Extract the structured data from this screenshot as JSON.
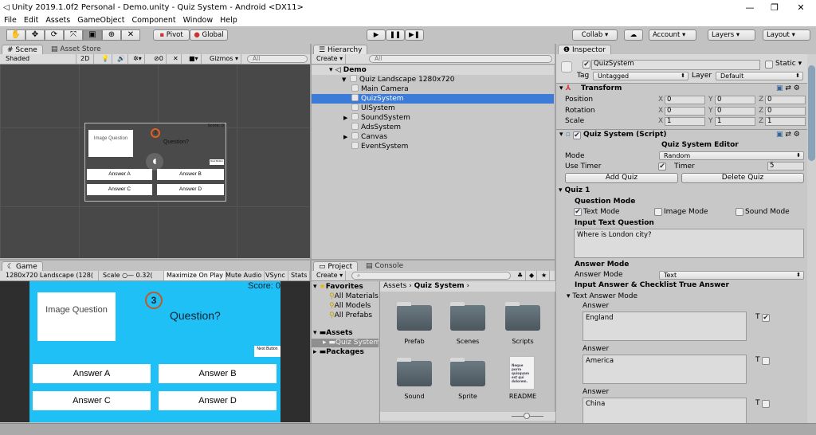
{
  "window": {
    "title": "Unity 2019.1.0f2 Personal - Demo.unity - Quiz System - Android <DX11>",
    "minimize": "—",
    "maximize": "❐",
    "close": "✕"
  },
  "menu": [
    "File",
    "Edit",
    "Assets",
    "GameObject",
    "Component",
    "Window",
    "Help"
  ],
  "toolbar": {
    "tools": [
      "✋",
      "✥",
      "⟳",
      "⤧",
      "▣",
      "⊕",
      "✕"
    ],
    "pivot": "Pivot",
    "global": "Global",
    "play": "▶",
    "pause": "❚❚",
    "step": "▶❚",
    "collab": "Collab ▾",
    "cloud": "☁",
    "account": "Account",
    "layers": "Layers",
    "layout": "Layout"
  },
  "scene": {
    "tab": "Scene",
    "tab2": "Asset Store",
    "shading": "Shaded",
    "mode2d": "2D",
    "hidden_count": "0",
    "gizmos": "Gizmos",
    "search": "All",
    "mini": {
      "image": "Image Question",
      "timer": "3",
      "question": "Question?",
      "score": "Score: 0",
      "next": "Next Button",
      "answers": [
        "Answer A",
        "Answer B",
        "Answer C",
        "Answer D"
      ]
    }
  },
  "game": {
    "tab": "Game",
    "resolution": "1280x720 Landscape (128(",
    "scale_label": "Scale",
    "scale_value": "0.32(",
    "maximize": "Maximize On Play",
    "mute": "Mute Audio",
    "vsync": "VSync",
    "stats": "Stats",
    "image": "Image Question",
    "timer": "3",
    "question": "Question?",
    "score": "Score: 0",
    "next": "Next Button",
    "answers": [
      "Answer A",
      "Answer B",
      "Answer C",
      "Answer D"
    ],
    "bg": "#1ec0f5"
  },
  "hierarchy": {
    "tab": "Hierarchy",
    "create": "Create",
    "search": "All",
    "scene": "Demo",
    "items": [
      {
        "label": "Quiz Landscape 1280x720",
        "depth": 1,
        "expand": "▼"
      },
      {
        "label": "Main Camera",
        "depth": 2,
        "expand": ""
      },
      {
        "label": "QuizSystem",
        "depth": 2,
        "expand": "",
        "selected": true
      },
      {
        "label": "UISystem",
        "depth": 2,
        "expand": ""
      },
      {
        "label": "SoundSystem",
        "depth": 2,
        "expand": "▶"
      },
      {
        "label": "AdsSystem",
        "depth": 2,
        "expand": ""
      },
      {
        "label": "Canvas",
        "depth": 2,
        "expand": "▶"
      },
      {
        "label": "EventSystem",
        "depth": 2,
        "expand": ""
      }
    ]
  },
  "project": {
    "tab": "Project",
    "tab2": "Console",
    "create": "Create",
    "favorites": "Favorites",
    "fav_items": [
      "All Materials",
      "All Models",
      "All Prefabs"
    ],
    "assets": "Assets",
    "quiz_folder": "Quiz System",
    "packages": "Packages",
    "breadcrumb": [
      "Assets",
      "Quiz System"
    ],
    "files": [
      "Prefab",
      "Scenes",
      "Scripts",
      "Sound",
      "Sprite",
      "README"
    ],
    "readme_preview": "Neque porro quisquam est qui dolorem."
  },
  "inspector": {
    "tab": "Inspector",
    "name": "QuizSystem",
    "static": "Static",
    "tag_label": "Tag",
    "tag": "Untagged",
    "layer_label": "Layer",
    "layer": "Default",
    "transform": {
      "title": "Transform",
      "rows": [
        {
          "label": "Position",
          "x": "0",
          "y": "0",
          "z": "0"
        },
        {
          "label": "Rotation",
          "x": "0",
          "y": "0",
          "z": "0"
        },
        {
          "label": "Scale",
          "x": "1",
          "y": "1",
          "z": "1"
        }
      ]
    },
    "script": {
      "title": "Quiz System (Script)",
      "editor_title": "Quiz System Editor",
      "mode_label": "Mode",
      "mode": "Random",
      "use_timer": "Use Timer",
      "timer_label": "Timer",
      "timer": "5",
      "add": "Add Quiz",
      "delete": "Delete Quiz"
    },
    "quiz": {
      "title": "Quiz 1",
      "question_mode": "Question Mode",
      "text_mode": "Text Mode",
      "image_mode": "Image Mode",
      "sound_mode": "Sound Mode",
      "input_text": "Input Text Question",
      "question": "Where is London city?",
      "answer_mode_h": "Answer Mode",
      "answer_mode_label": "Answer Mode",
      "answer_mode": "Text",
      "input_answer": "Input Answer & Checklist True Answer",
      "text_answer_mode": "Text Answer Mode",
      "answers": [
        {
          "label": "Answer",
          "value": "England",
          "t": "T",
          "correct": true
        },
        {
          "label": "Answer",
          "value": "America",
          "t": "T",
          "correct": false
        },
        {
          "label": "Answer",
          "value": "China",
          "t": "T",
          "correct": false
        }
      ]
    }
  }
}
